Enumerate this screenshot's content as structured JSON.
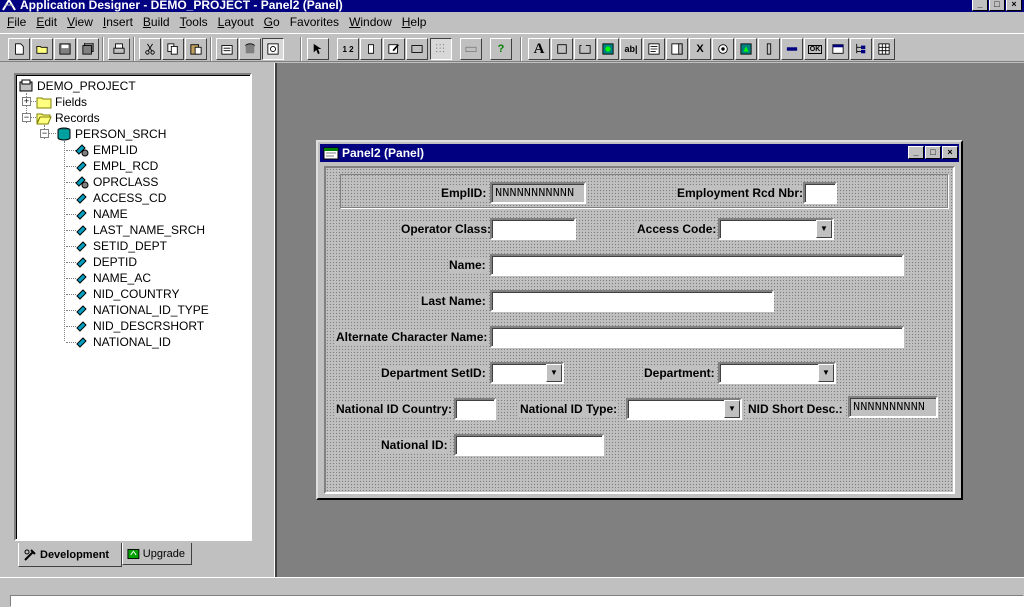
{
  "window": {
    "title": "Application Designer - DEMO_PROJECT - Panel2 (Panel)"
  },
  "menu": [
    {
      "key": "F",
      "rest": "ile"
    },
    {
      "key": "E",
      "rest": "dit"
    },
    {
      "key": "V",
      "rest": "iew"
    },
    {
      "key": "I",
      "rest": "nsert"
    },
    {
      "key": "B",
      "rest": "uild"
    },
    {
      "key": "T",
      "rest": "ools"
    },
    {
      "key": "L",
      "rest": "ayout"
    },
    {
      "key": "G",
      "rest": "o"
    },
    {
      "key": "",
      "rest": "Favorites"
    },
    {
      "key": "W",
      "rest": "indow"
    },
    {
      "key": "H",
      "rest": "elp"
    }
  ],
  "toolbar": {
    "btn_num": "1 2",
    "btn_help": "?",
    "btn_text": "A",
    "btn_edit": "ab|",
    "btn_ok": "OK",
    "btn_x": "X"
  },
  "tree": {
    "project": "DEMO_PROJECT",
    "fields": "Fields",
    "records": "Records",
    "record": "PERSON_SRCH",
    "record_fields": [
      {
        "name": "EMPLID",
        "key": true
      },
      {
        "name": "EMPL_RCD",
        "key": false
      },
      {
        "name": "OPRCLASS",
        "key": true
      },
      {
        "name": "ACCESS_CD",
        "key": false
      },
      {
        "name": "NAME",
        "key": false
      },
      {
        "name": "LAST_NAME_SRCH",
        "key": false
      },
      {
        "name": "SETID_DEPT",
        "key": false
      },
      {
        "name": "DEPTID",
        "key": false
      },
      {
        "name": "NAME_AC",
        "key": false
      },
      {
        "name": "NID_COUNTRY",
        "key": false
      },
      {
        "name": "NATIONAL_ID_TYPE",
        "key": false
      },
      {
        "name": "NID_DESCRSHORT",
        "key": false
      },
      {
        "name": "NATIONAL_ID",
        "key": false
      }
    ]
  },
  "tabs": {
    "development": "Development",
    "upgrade": "Upgrade"
  },
  "panel": {
    "title": "Panel2 (Panel)",
    "labels": {
      "emplid": "EmplID:",
      "empl_rcd": "Employment Rcd Nbr:",
      "oprclass": "Operator Class:",
      "access_cd": "Access Code:",
      "name": "Name:",
      "last_name": "Last Name:",
      "alt_name": "Alternate Character Name:",
      "dept_setid": "Department SetID:",
      "dept": "Department:",
      "nid_country": "National ID Country:",
      "nid_type": "National ID Type:",
      "nid_short": "NID Short Desc.:",
      "nid": "National ID:"
    },
    "values": {
      "emplid": "NNNNNNNNNNN",
      "nid_short": "NNNNNNNNNN"
    }
  }
}
